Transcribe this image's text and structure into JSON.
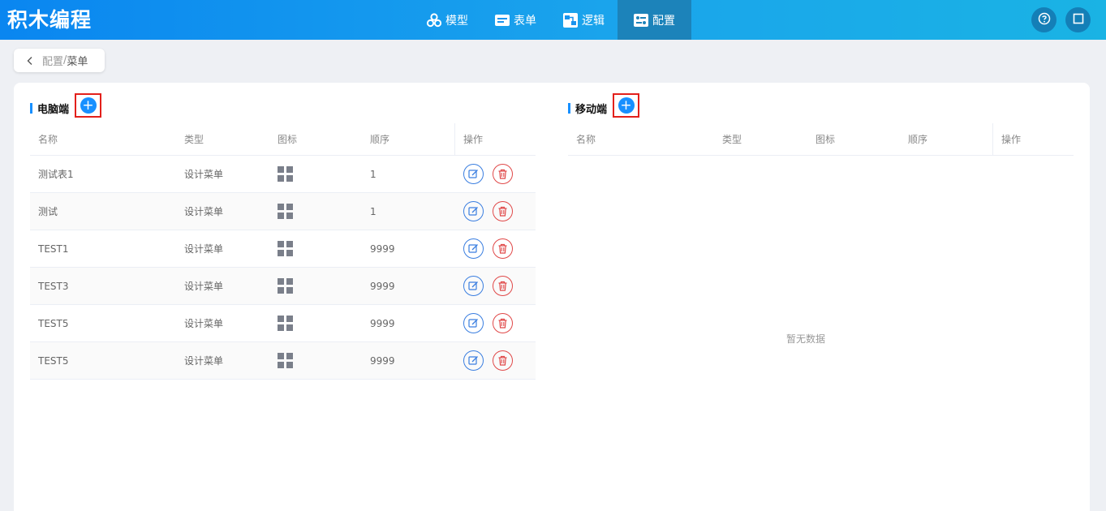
{
  "app": {
    "title": "积木编程"
  },
  "nav": [
    {
      "label": "模型",
      "icon": "cubes-icon",
      "active": false
    },
    {
      "label": "表单",
      "icon": "form-icon",
      "active": false
    },
    {
      "label": "逻辑",
      "icon": "logic-icon",
      "active": false
    },
    {
      "label": "配置",
      "icon": "config-icon",
      "active": true
    }
  ],
  "header_buttons": [
    {
      "icon": "help-icon"
    },
    {
      "icon": "fullscreen-icon"
    }
  ],
  "breadcrumb": {
    "part1": "配置",
    "separator": "/",
    "part2": "菜单"
  },
  "desktop": {
    "title": "电脑端",
    "add_label": "+",
    "columns": [
      "名称",
      "类型",
      "图标",
      "顺序",
      "操作"
    ],
    "rows": [
      {
        "name": "测试表1",
        "type": "设计菜单",
        "icon": "grid-icon",
        "order": "1"
      },
      {
        "name": "测试",
        "type": "设计菜单",
        "icon": "grid-icon",
        "order": "1"
      },
      {
        "name": "TEST1",
        "type": "设计菜单",
        "icon": "grid-icon",
        "order": "9999"
      },
      {
        "name": "TEST3",
        "type": "设计菜单",
        "icon": "grid-icon",
        "order": "9999"
      },
      {
        "name": "TEST5",
        "type": "设计菜单",
        "icon": "grid-icon",
        "order": "9999"
      },
      {
        "name": "TEST5",
        "type": "设计菜单",
        "icon": "grid-icon",
        "order": "9999"
      }
    ]
  },
  "mobile": {
    "title": "移动端",
    "add_label": "+",
    "columns": [
      "名称",
      "类型",
      "图标",
      "顺序",
      "操作"
    ],
    "empty_text": "暂无数据"
  },
  "colors": {
    "accent": "#1890ff",
    "header_start": "#0a86f0",
    "header_end": "#1ab3e4",
    "danger": "#e04848",
    "highlight": "#e3201b"
  }
}
